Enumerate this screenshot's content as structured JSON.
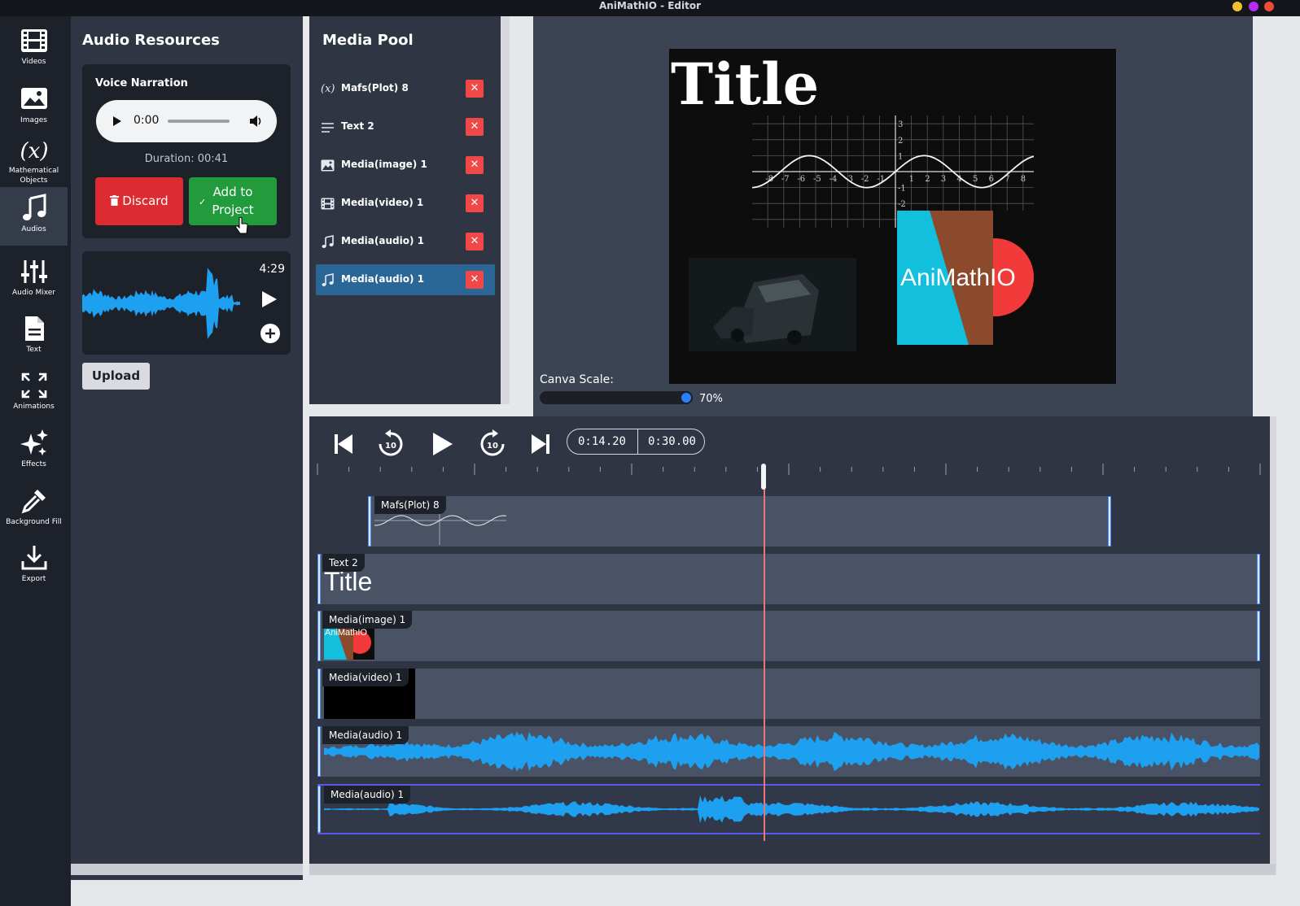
{
  "window": {
    "title": "AniMathIO - Editor"
  },
  "sidebar": {
    "items": [
      {
        "label": "Videos",
        "icon": "film-icon"
      },
      {
        "label": "Images",
        "icon": "image-icon"
      },
      {
        "label": "Mathematical Objects",
        "icon": "function-x-icon"
      },
      {
        "label": "Audios",
        "icon": "music-note-icon"
      },
      {
        "label": "Audio Mixer",
        "icon": "sliders-icon"
      },
      {
        "label": "Text",
        "icon": "document-icon"
      },
      {
        "label": "Animations",
        "icon": "expand-arrows-icon"
      },
      {
        "label": "Effects",
        "icon": "sparkles-icon"
      },
      {
        "label": "Background Fill",
        "icon": "eyedropper-icon"
      },
      {
        "label": "Export",
        "icon": "download-icon"
      }
    ],
    "active": "Audios"
  },
  "audio_panel": {
    "title": "Audio Resources",
    "narration": {
      "title": "Voice Narration",
      "player_time": "0:00",
      "duration": "Duration: 00:41",
      "discard_label": "Discard",
      "add_label_1": "Add to",
      "add_label_2": "Project"
    },
    "clip": {
      "duration": "4:29"
    },
    "upload_label": "Upload"
  },
  "media_pool": {
    "title": "Media Pool",
    "items": [
      {
        "label": "Mafs(Plot) 8",
        "icon": "function-x-icon"
      },
      {
        "label": "Text 2",
        "icon": "text-lines-icon"
      },
      {
        "label": "Media(image) 1",
        "icon": "image-icon"
      },
      {
        "label": "Media(video) 1",
        "icon": "film-icon"
      },
      {
        "label": "Media(audio) 1",
        "icon": "music-note-icon"
      },
      {
        "label": "Media(audio) 1",
        "icon": "music-note-icon",
        "selected": true
      }
    ]
  },
  "preview": {
    "canvas_title": "Title",
    "logo_text": "AniMathIO",
    "canva_scale_label": "Canva Scale:",
    "canva_scale_value": "70%",
    "canva_scale_fraction": 0.7,
    "plot_x_ticks": [
      "-8",
      "-7",
      "-6",
      "-5",
      "-4",
      "-3",
      "-2",
      "-1",
      "1",
      "2",
      "3",
      "4",
      "5",
      "6",
      "7",
      "8"
    ],
    "plot_y_ticks": [
      "3",
      "2",
      "1",
      "-1",
      "-2"
    ]
  },
  "timeline": {
    "current_time": "0:14.20",
    "total_time": "0:30.00",
    "tracks": [
      {
        "label": "Mafs(Plot) 8"
      },
      {
        "label": "Text 2",
        "preview_text": "Title"
      },
      {
        "label": "Media(image) 1",
        "preview_text": "AniMathIO"
      },
      {
        "label": "Media(video) 1"
      },
      {
        "label": "Media(audio) 1"
      },
      {
        "label": "Media(audio) 1"
      }
    ]
  },
  "colors": {
    "accent_blue": "#2a7fff",
    "waveform": "#1ea0f0",
    "discard_red": "#dc2b31",
    "add_green": "#229b3c",
    "delete_red": "#f04747",
    "logo_cyan": "#12c0de",
    "logo_brown": "#8b4a2b",
    "logo_red": "#f23a3a"
  }
}
